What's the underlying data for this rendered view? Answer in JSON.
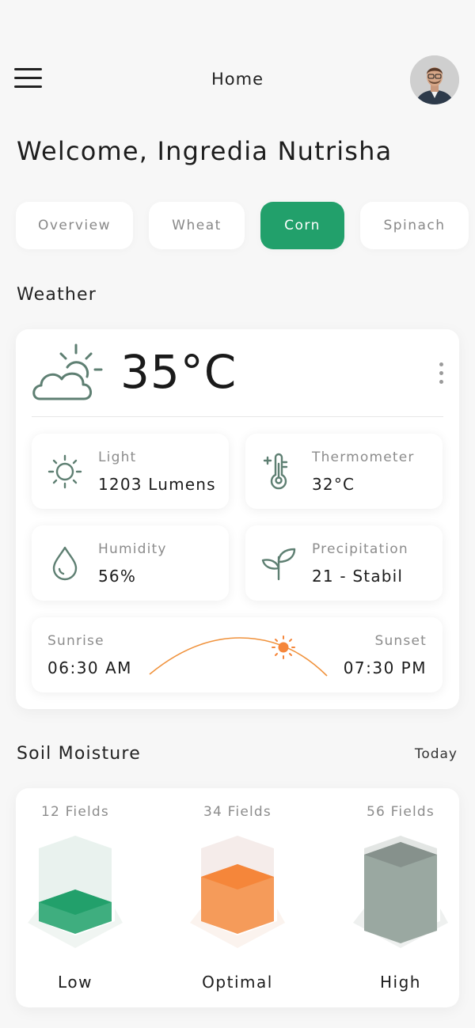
{
  "header": {
    "title": "Home",
    "welcome": "Welcome, Ingredia Nutrisha"
  },
  "tabs": [
    {
      "label": "Overview",
      "active": false
    },
    {
      "label": "Wheat",
      "active": false
    },
    {
      "label": "Corn",
      "active": true
    },
    {
      "label": "Spinach",
      "active": false
    }
  ],
  "weather": {
    "section_title": "Weather",
    "icon": "cloud-sun-icon",
    "temperature": "35°C",
    "stats": [
      {
        "label": "Light",
        "value": "1203 Lumens",
        "icon": "sun-icon"
      },
      {
        "label": "Thermometer",
        "value": "32°C",
        "icon": "thermometer-icon"
      },
      {
        "label": "Humidity",
        "value": "56%",
        "icon": "droplet-icon"
      },
      {
        "label": "Precipitation",
        "value": "21 - Stabil",
        "icon": "sprout-icon"
      }
    ],
    "sunrise_label": "Sunrise",
    "sunrise_time": "06:30 AM",
    "sunset_label": "Sunset",
    "sunset_time": "07:30 PM"
  },
  "soil": {
    "section_title": "Soil Moisture",
    "period": "Today",
    "columns": [
      {
        "fields": "12 Fields",
        "level": "Low",
        "fill": 0.3,
        "color": "#22a06b"
      },
      {
        "fields": "34 Fields",
        "level": "Optimal",
        "fill": 0.7,
        "color": "#f5863a"
      },
      {
        "fields": "56 Fields",
        "level": "High",
        "fill": 1.0,
        "color": "#8d9a94"
      }
    ]
  },
  "colors": {
    "accent": "#22a06b",
    "sun_arc": "#f0923c",
    "icon_stroke": "#5e7f72"
  }
}
